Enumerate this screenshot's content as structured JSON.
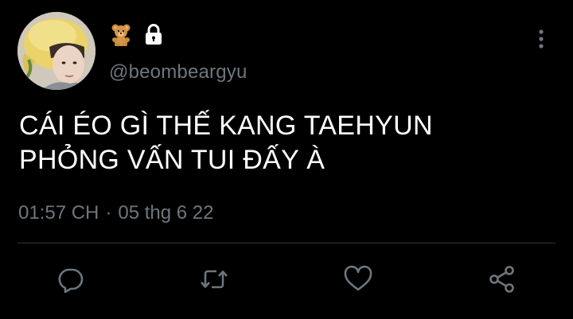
{
  "profile": {
    "handle": "@beombeargyu",
    "avatar_icon": "profile-photo",
    "badges": [
      "teddy-bear-emoji",
      "lock-icon"
    ]
  },
  "tweet": {
    "line1": "CÁI ÉO GÌ THẾ KANG TAEHYUN",
    "line2": "PHỎNG VẤN TUI ĐẤY À"
  },
  "meta": {
    "time": "01:57 CH",
    "separator": "·",
    "date": "05 thg 6 22"
  },
  "actions": [
    "reply-icon",
    "retweet-icon",
    "like-icon",
    "share-icon"
  ],
  "colors": {
    "background": "#000000",
    "text": "#ffffff",
    "muted": "#6e767d",
    "divider": "#2f3336"
  }
}
